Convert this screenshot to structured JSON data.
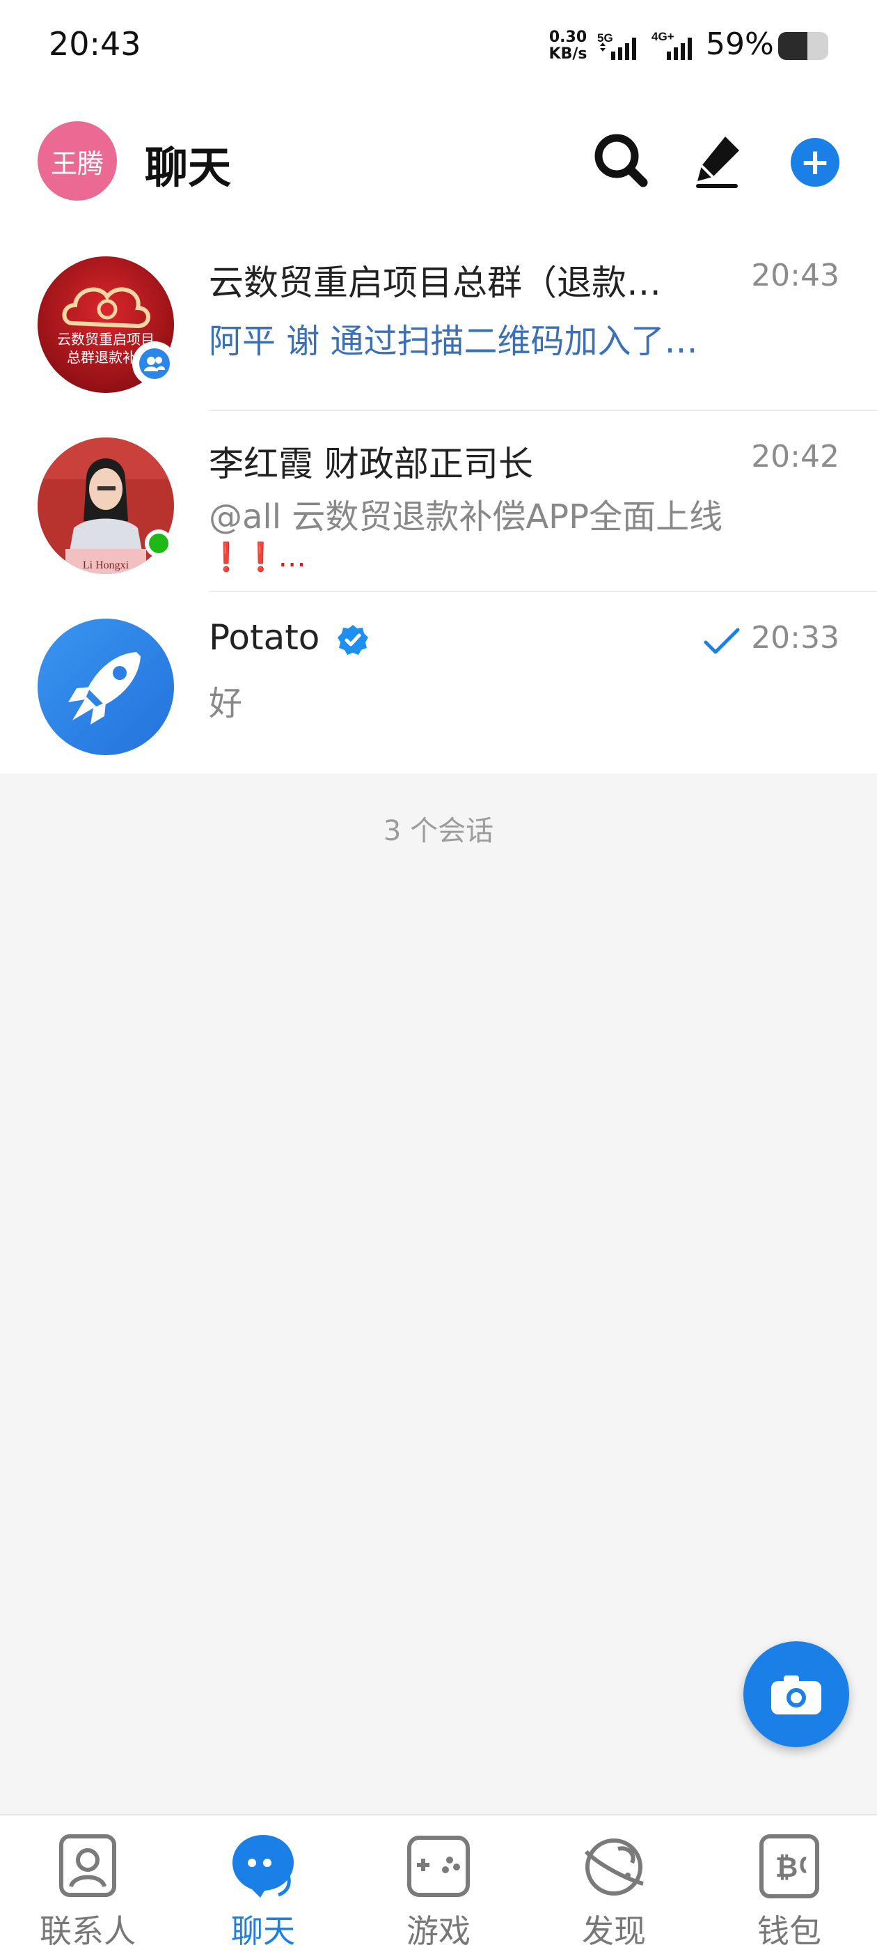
{
  "status_bar": {
    "time": "20:43",
    "net_speed_value": "0.30",
    "net_speed_unit": "KB/s",
    "signal1_label": "5G",
    "signal2_label": "4G+",
    "battery_percent": "59%",
    "battery_level": 0.59
  },
  "header": {
    "avatar_text": "王腾",
    "title": "聊天",
    "icons": [
      "search-icon",
      "compose-icon",
      "plus-icon"
    ],
    "accent_color": "#1a7fe6"
  },
  "chats": [
    {
      "name": "云数贸重启项目总群（退款…",
      "time": "20:43",
      "preview": "阿平 谢 通过扫描二维码加入了…",
      "preview_color": "#3b6fb6",
      "avatar_text_line1": "云数贸重启项目",
      "avatar_text_line2": "总群退款补",
      "badge": "group-icon"
    },
    {
      "name": "李红霞 财政部正司长",
      "time": "20:42",
      "preview_line1": "@all 云数贸退款补偿APP全面上线",
      "preview_line2": "❗❗…",
      "avatar_caption": "Li Hongxi",
      "status": "online"
    },
    {
      "name": "Potato",
      "time": "20:33",
      "preview": "好",
      "verified": true,
      "read_status": "check-icon"
    }
  ],
  "conversation_count": "3 个会话",
  "fab": {
    "icon": "camera-icon"
  },
  "tabs": [
    {
      "label": "联系人",
      "icon": "contacts-icon",
      "active": false
    },
    {
      "label": "聊天",
      "icon": "chat-icon",
      "active": true
    },
    {
      "label": "游戏",
      "icon": "gamepad-icon",
      "active": false
    },
    {
      "label": "发现",
      "icon": "discover-icon",
      "active": false
    },
    {
      "label": "钱包",
      "icon": "wallet-icon",
      "active": false
    }
  ]
}
